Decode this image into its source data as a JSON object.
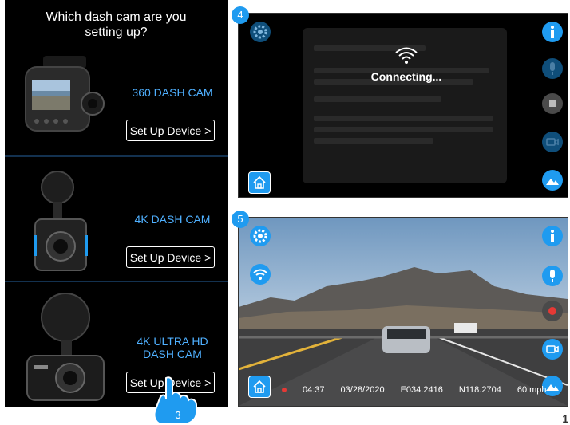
{
  "phone": {
    "title": "Which dash cam are you\nsetting up?",
    "cameras": [
      {
        "name": "360 DASH CAM",
        "button": "Set Up Device >"
      },
      {
        "name": "4K DASH CAM",
        "button": "Set Up Device >"
      },
      {
        "name": "4K ULTRA HD\nDASH CAM",
        "button": "Set Up Device >"
      }
    ],
    "step_badge": "3"
  },
  "screen4": {
    "badge": "4",
    "status": "Connecting..."
  },
  "screen5": {
    "badge": "5",
    "rec_time": "04:37",
    "date": "03/28/2020",
    "lon": "E034.2416",
    "lat": "N118.2704",
    "speed": "60 mph"
  },
  "page_number": "1",
  "colors": {
    "accent": "#1f9bf0",
    "record": "#e53935",
    "label_blue": "#4fb0ff"
  }
}
